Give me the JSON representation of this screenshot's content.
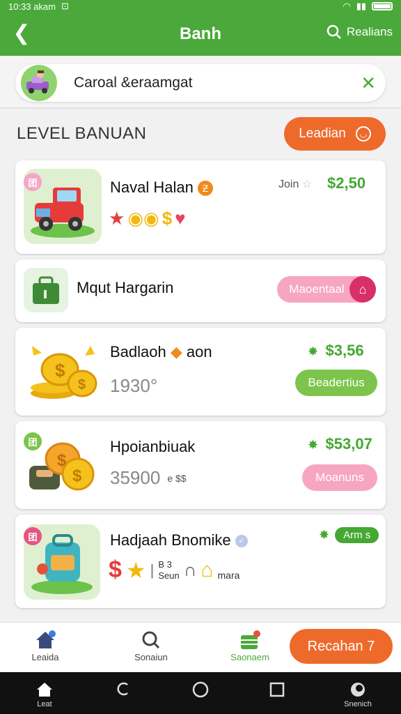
{
  "status": {
    "time": "10:33 akam",
    "sim": "⊡"
  },
  "appbar": {
    "title": "Banh",
    "search_label": "Realians"
  },
  "search": {
    "query": "Caroal &eraamgat"
  },
  "section": {
    "title": "LEVEL BANUAN",
    "action_label": "Leadian"
  },
  "items": [
    {
      "name": "Naval Halan",
      "meta": "Join",
      "price": "$2,50",
      "badge": "团"
    },
    {
      "name": "Mqut Hargarin",
      "button": "Maoentaal"
    },
    {
      "name": "Badlaoh",
      "name_suffix": "aon",
      "sub": "1930°",
      "price": "$3,56",
      "button": "Beadertius"
    },
    {
      "name": "Hpoianbiuak",
      "sub": "35900",
      "sub_extra": "e $$",
      "price": "$53,07",
      "button": "Moanuns",
      "badge": "团"
    },
    {
      "name": "Hadjaah Bnomike",
      "label_a": "B 3",
      "label_b": "Seun",
      "label_c": "mara",
      "price_button": "Arm s",
      "badge": "团"
    }
  ],
  "bottom_nav": [
    {
      "label": "Leaida"
    },
    {
      "label": "Sonaiun"
    },
    {
      "label": "Saonaem"
    }
  ],
  "cta": {
    "label": "Recahan 7"
  },
  "system_nav": {
    "home_label": "Leat",
    "last_label": "Snenich"
  }
}
